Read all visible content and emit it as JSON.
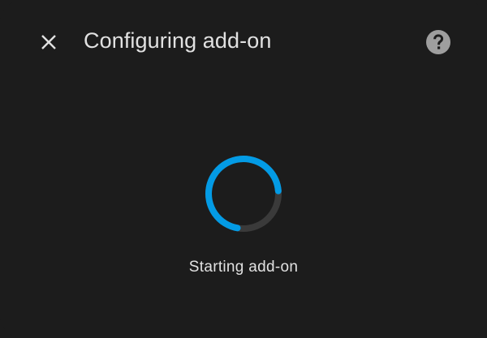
{
  "dialog": {
    "title": "Configuring add-on",
    "close_icon": "close-icon",
    "help_icon": "help-circle-icon"
  },
  "progress": {
    "status_text": "Starting add-on",
    "spinner_color": "#039be5",
    "track_color": "#3a3a3a",
    "indeterminate": true
  },
  "colors": {
    "background": "#1c1c1c",
    "text": "#e1e1e1",
    "icon": "#9e9e9e"
  }
}
